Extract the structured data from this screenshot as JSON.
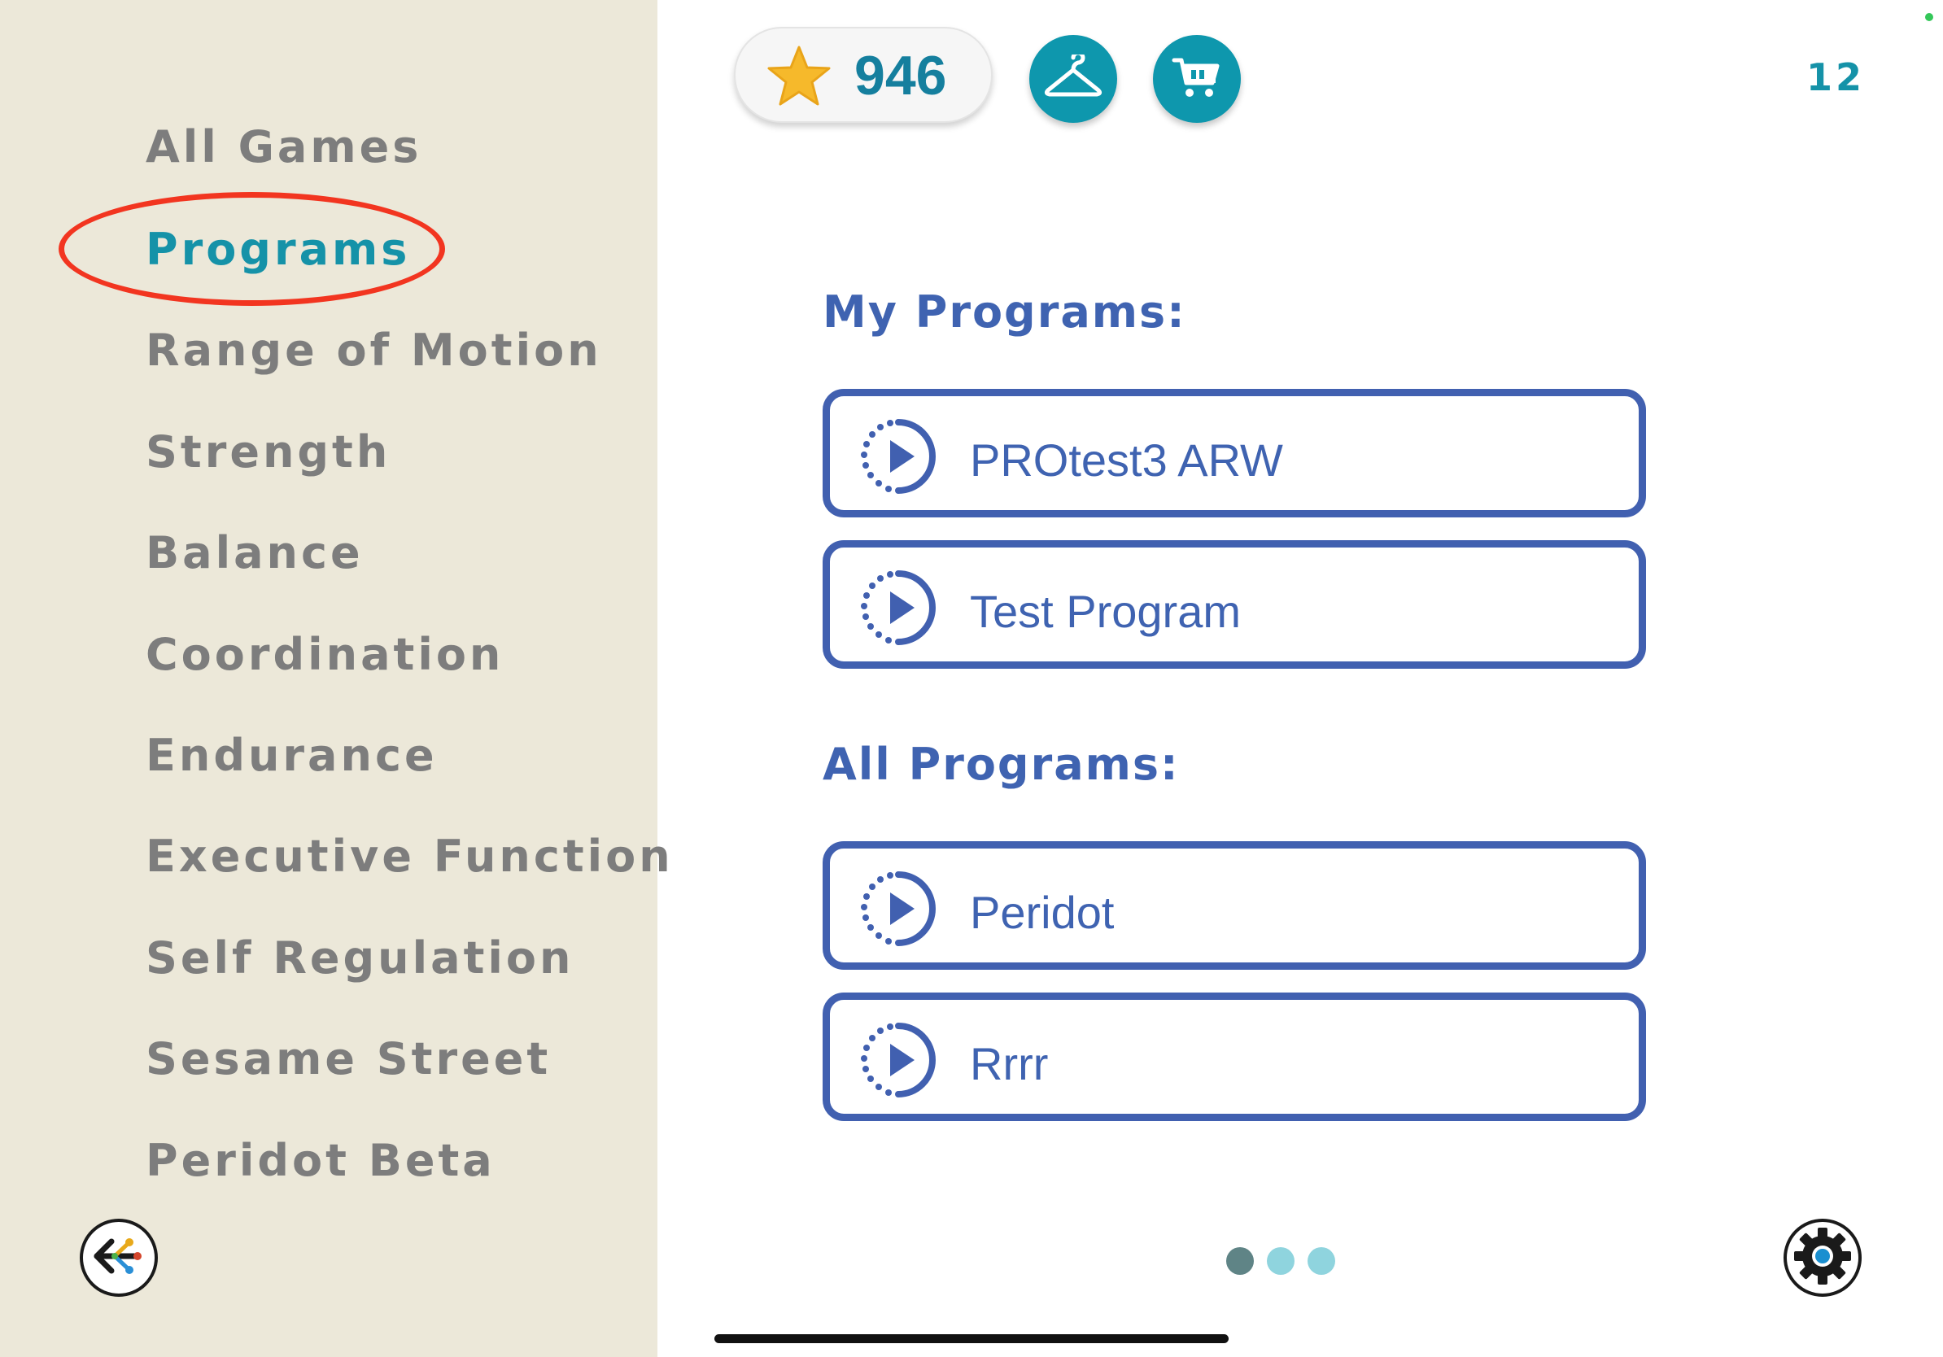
{
  "sidebar": {
    "items": [
      {
        "label": "All Games"
      },
      {
        "label": "Programs",
        "active": true
      },
      {
        "label": "Range of Motion"
      },
      {
        "label": "Strength"
      },
      {
        "label": "Balance"
      },
      {
        "label": "Coordination"
      },
      {
        "label": "Endurance"
      },
      {
        "label": "Executive Function"
      },
      {
        "label": "Self Regulation"
      },
      {
        "label": "Sesame Street"
      },
      {
        "label": "Peridot Beta"
      }
    ],
    "exit_icon": "exit-arrow-icon"
  },
  "header": {
    "stars": "946",
    "star_icon": "star-icon",
    "wardrobe_icon": "hanger-icon",
    "store_icon": "cart-icon",
    "level": "12"
  },
  "main": {
    "my_programs_title": "My Programs:",
    "my_programs": [
      {
        "label": "PROtest3 ARW"
      },
      {
        "label": "Test Program"
      }
    ],
    "all_programs_title": "All Programs:",
    "all_programs": [
      {
        "label": "Peridot"
      },
      {
        "label": "Rrrr"
      }
    ],
    "page_indicator": {
      "pages": 3,
      "current": 1
    }
  },
  "settings_icon": "gear-icon",
  "colors": {
    "accent": "#1592a8",
    "program_blue": "#4160b0",
    "sidebar_bg": "#ece8d9",
    "highlight": "#f23520"
  }
}
